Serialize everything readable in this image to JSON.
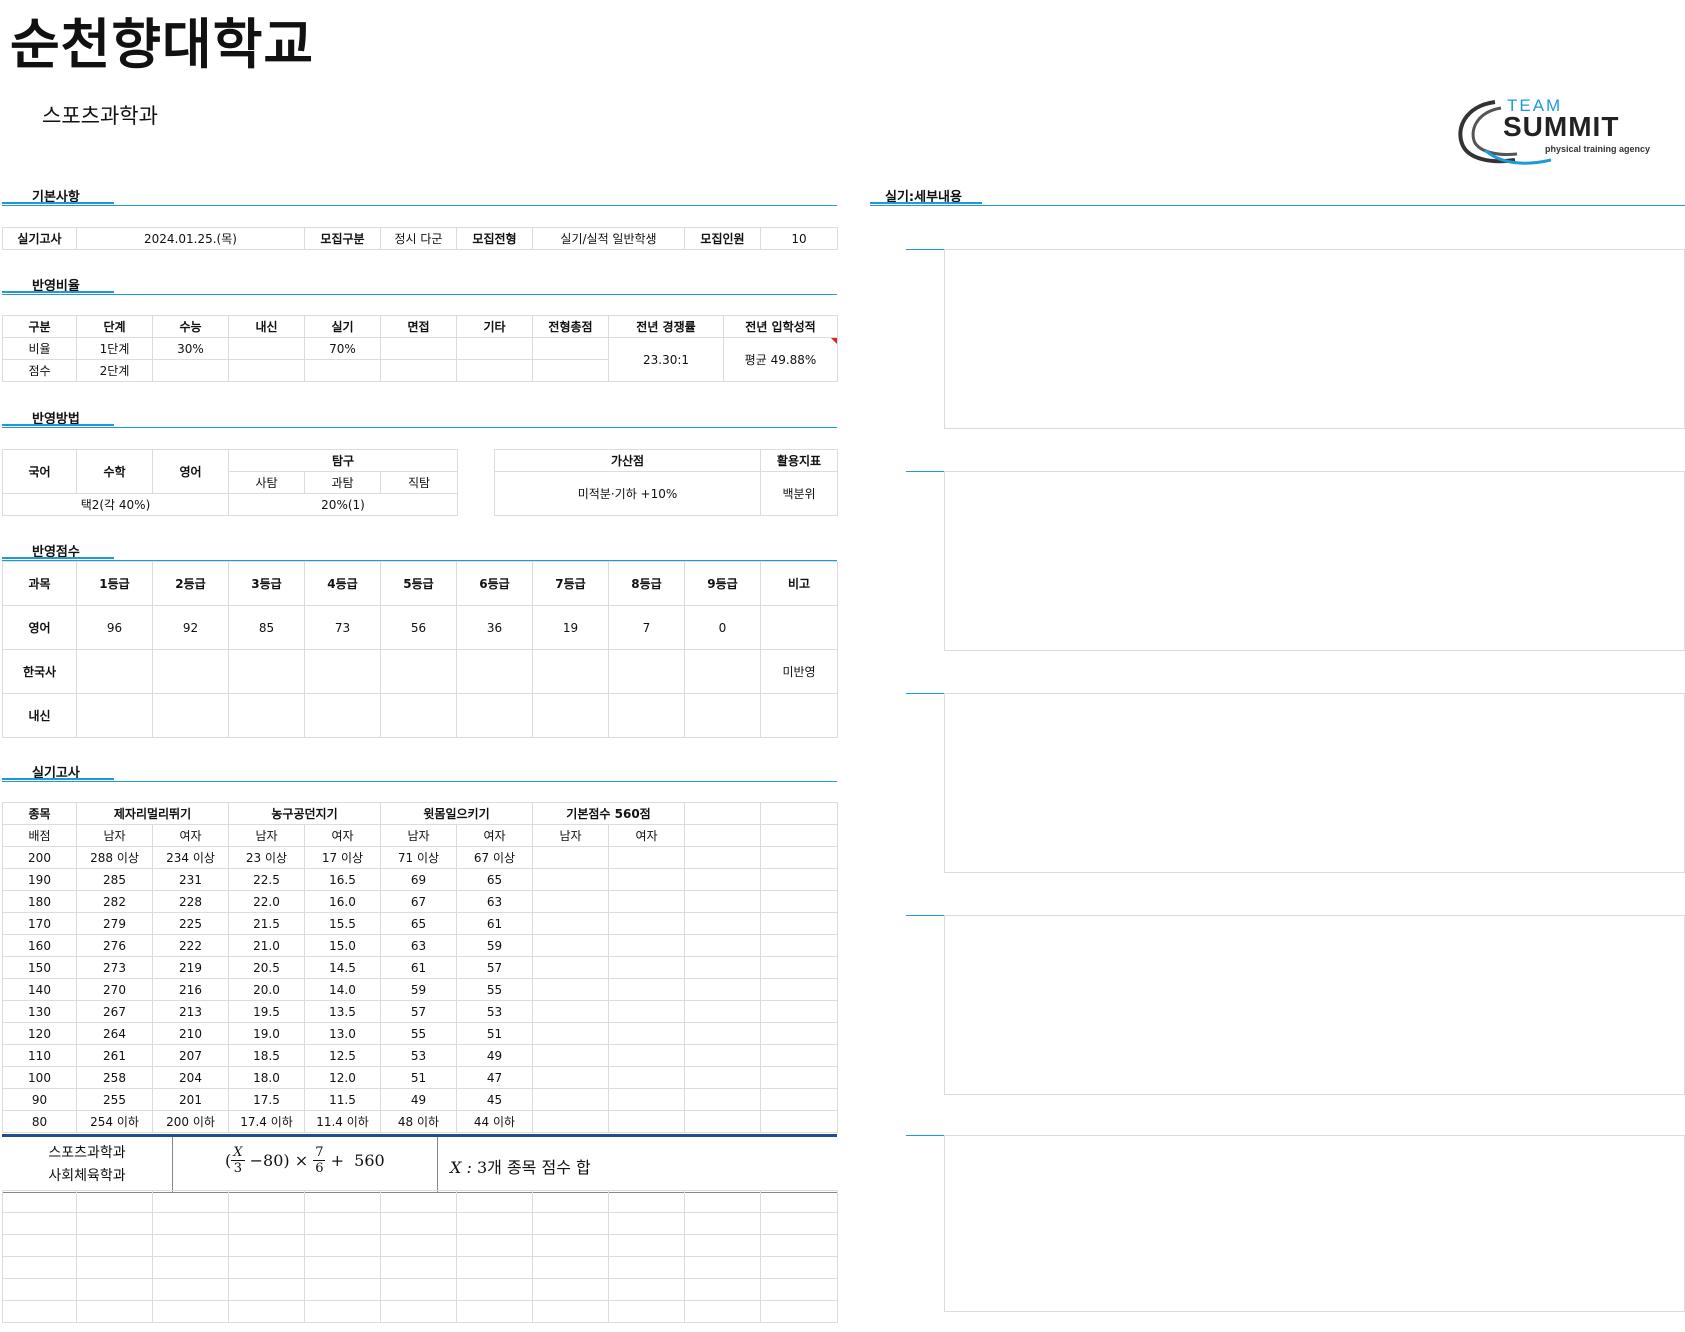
{
  "header": {
    "university": "순천향대학교",
    "department": "스포츠과학과",
    "logo": {
      "top": "TEAM",
      "main": "SUMMIT",
      "tagline": "physical training agency",
      "accent": "#1e9bd7"
    }
  },
  "sections": {
    "basic": "기본사항",
    "ratio": "반영비율",
    "method": "반영방법",
    "score": "반영점수",
    "practical": "실기고사",
    "detail": "실기:세부내용"
  },
  "basic": {
    "exam_label": "실기고사",
    "exam_date": "2024.01.25.(목)",
    "group_label": "모집구분",
    "group_value": "정시 다군",
    "type_label": "모집전형",
    "type_value": "실기/실적 일반학생",
    "quota_label": "모집인원",
    "quota_value": "10"
  },
  "ratio": {
    "headers": [
      "구분",
      "단계",
      "수능",
      "내신",
      "실기",
      "면접",
      "기타",
      "전형총점",
      "전년 경쟁률",
      "전년 입학성적"
    ],
    "rows": [
      [
        "비율",
        "1단계",
        "30%",
        "",
        "70%",
        "",
        "",
        ""
      ],
      [
        "점수",
        "2단계",
        "",
        "",
        "",
        "",
        "",
        ""
      ]
    ],
    "competition": "23.30:1",
    "prev_score": "평균 49.88%"
  },
  "method": {
    "korean": "국어",
    "math": "수학",
    "english": "영어",
    "inquiry": "탐구",
    "social": "사탐",
    "science": "과탐",
    "vocational": "직탐",
    "select_value": "택2(각 40%)",
    "inquiry_value": "20%(1)",
    "bonus_label": "가산점",
    "bonus_value": "미적분·기하 +10%",
    "index_label": "활용지표",
    "index_value": "백분위"
  },
  "score": {
    "headers": [
      "과목",
      "1등급",
      "2등급",
      "3등급",
      "4등급",
      "5등급",
      "6등급",
      "7등급",
      "8등급",
      "9등급",
      "비고"
    ],
    "rows": [
      [
        "영어",
        "96",
        "92",
        "85",
        "73",
        "56",
        "36",
        "19",
        "7",
        "0",
        ""
      ],
      [
        "한국사",
        "",
        "",
        "",
        "",
        "",
        "",
        "",
        "",
        "",
        "미반영"
      ],
      [
        "내신",
        "",
        "",
        "",
        "",
        "",
        "",
        "",
        "",
        "",
        ""
      ]
    ]
  },
  "practical": {
    "event_label": "종목",
    "events": [
      "제자리멀리뛰기",
      "농구공던지기",
      "윗몸일으키기",
      "기본점수 560점"
    ],
    "score_label": "배점",
    "male": "남자",
    "female": "여자",
    "rows": [
      [
        "200",
        "288 이상",
        "234 이상",
        "23 이상",
        "17 이상",
        "71 이상",
        "67 이상"
      ],
      [
        "190",
        "285",
        "231",
        "22.5",
        "16.5",
        "69",
        "65"
      ],
      [
        "180",
        "282",
        "228",
        "22.0",
        "16.0",
        "67",
        "63"
      ],
      [
        "170",
        "279",
        "225",
        "21.5",
        "15.5",
        "65",
        "61"
      ],
      [
        "160",
        "276",
        "222",
        "21.0",
        "15.0",
        "63",
        "59"
      ],
      [
        "150",
        "273",
        "219",
        "20.5",
        "14.5",
        "61",
        "57"
      ],
      [
        "140",
        "270",
        "216",
        "20.0",
        "14.0",
        "59",
        "55"
      ],
      [
        "130",
        "267",
        "213",
        "19.5",
        "13.5",
        "57",
        "53"
      ],
      [
        "120",
        "264",
        "210",
        "19.0",
        "13.0",
        "55",
        "51"
      ],
      [
        "110",
        "261",
        "207",
        "18.5",
        "12.5",
        "53",
        "49"
      ],
      [
        "100",
        "258",
        "204",
        "18.0",
        "12.0",
        "51",
        "47"
      ],
      [
        "90",
        "255",
        "201",
        "17.5",
        "11.5",
        "49",
        "45"
      ],
      [
        "80",
        "254 이하",
        "200 이하",
        "17.4 이하",
        "11.4 이하",
        "48 이하",
        "44 이하"
      ]
    ]
  },
  "formula": {
    "dept1": "스포츠과학과",
    "dept2": "사회체육학과",
    "open": "(",
    "x": "X",
    "three": "3",
    "minus": "−80) ×",
    "seven": "7",
    "six": "6",
    "plus": "+  560",
    "desc_var": "X :",
    "desc": "3개 종목 점수 합"
  }
}
